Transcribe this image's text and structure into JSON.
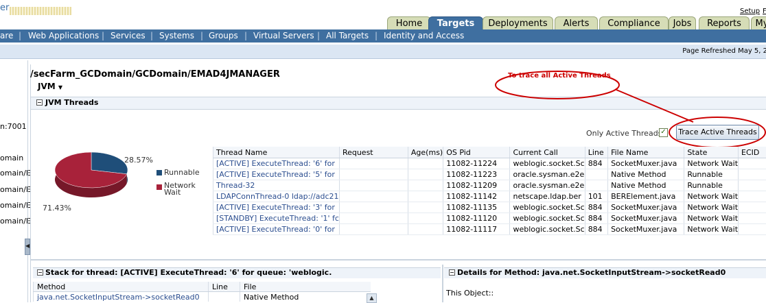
{
  "header": {
    "brand_fragment": "er",
    "setup_label": "Setup",
    "help_fragment": "F",
    "tabs": [
      {
        "label": "Home",
        "active": false
      },
      {
        "label": "Targets",
        "active": true
      },
      {
        "label": "Deployments",
        "active": false
      },
      {
        "label": "Alerts",
        "active": false
      },
      {
        "label": "Compliance",
        "active": false
      },
      {
        "label": "Jobs",
        "active": false
      },
      {
        "label": "Reports",
        "active": false
      },
      {
        "label": "My",
        "active": false
      }
    ]
  },
  "subnav": {
    "items": [
      "are",
      "Web Applications",
      "Services",
      "Systems",
      "Groups",
      "Virtual Servers",
      "All Targets",
      "Identity and Access"
    ]
  },
  "refresh_text": "Page Refreshed May 5, 2",
  "left_rail": {
    "items": [
      "n:7001",
      "omain",
      "omain/E",
      "omain/E",
      "omain/E",
      "omain/E"
    ]
  },
  "breadcrumb": "/secFarm_GCDomain/GCDomain/EMAD4JMANAGER",
  "jvm_menu_label": "JVM",
  "threads_section_title": "JVM Threads",
  "annotation": {
    "text": "To trace all Active Threads",
    "color": "#cc0000"
  },
  "only_active_label": "Only Active Threads",
  "only_active_checked": true,
  "trace_button_label": "Trace Active Threads",
  "chart_data": {
    "type": "pie",
    "title": "",
    "series": [
      {
        "name": "Runnable",
        "value": 28.57,
        "label": "28.57%",
        "color": "#1f4e79"
      },
      {
        "name": "Network Wait",
        "value": 71.43,
        "label": "71.43%",
        "color": "#a8223a"
      }
    ],
    "legend": [
      "Runnable",
      "Network Wait"
    ],
    "legend_placement": "right"
  },
  "threads_table": {
    "columns": [
      "Thread Name",
      "Request",
      "Age(ms)",
      "OS Pid",
      "Current Call",
      "Line",
      "File Name",
      "State",
      "ECID"
    ],
    "rows": [
      [
        "[ACTIVE] ExecuteThread: '6' for",
        "",
        "",
        "11082-11224",
        "weblogic.socket.Sc",
        "884",
        "SocketMuxer.java",
        "Network Wait",
        ""
      ],
      [
        "[ACTIVE] ExecuteThread: '5' for",
        "",
        "",
        "11082-11223",
        "oracle.sysman.e2e",
        "",
        "Native Method",
        "Runnable",
        ""
      ],
      [
        "Thread-32",
        "",
        "",
        "11082-11209",
        "oracle.sysman.e2e",
        "",
        "Native Method",
        "Runnable",
        ""
      ],
      [
        "LDAPConnThread-0 ldap://adc21",
        "",
        "",
        "11082-11142",
        "netscape.ldap.ber",
        "101",
        "BERElement.java",
        "Network Wait",
        ""
      ],
      [
        "[ACTIVE] ExecuteThread: '3' for",
        "",
        "",
        "11082-11135",
        "weblogic.socket.Sc",
        "884",
        "SocketMuxer.java",
        "Network Wait",
        ""
      ],
      [
        "[STANDBY] ExecuteThread: '1' fc",
        "",
        "",
        "11082-11120",
        "weblogic.socket.Sc",
        "884",
        "SocketMuxer.java",
        "Network Wait",
        ""
      ],
      [
        "[ACTIVE] ExecuteThread: '0' for",
        "",
        "",
        "11082-11117",
        "weblogic.socket.Sc",
        "884",
        "SocketMuxer.java",
        "Network Wait",
        ""
      ]
    ]
  },
  "stack_panel": {
    "title": "Stack for thread: [ACTIVE] ExecuteThread: '6' for queue: 'weblogic.",
    "columns": [
      "Method",
      "Line",
      "File"
    ],
    "rows": [
      [
        "java.net.SocketInputStream->socketRead0",
        "",
        "Native Method"
      ]
    ]
  },
  "details_panel": {
    "title": "Details for Method: java.net.SocketInputStream->socketRead0",
    "this_object_label": "This Object::"
  }
}
